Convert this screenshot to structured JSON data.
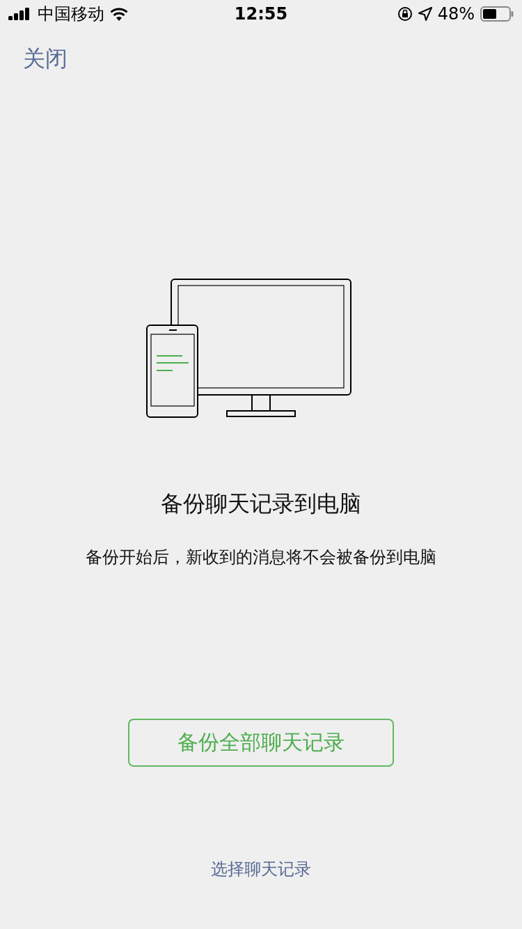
{
  "status_bar": {
    "carrier": "中国移动",
    "time": "12:55",
    "battery": "48%"
  },
  "nav": {
    "close": "关闭"
  },
  "title": "备份聊天记录到电脑",
  "description": "备份开始后，新收到的消息将不会被备份到电脑",
  "primary_button": "备份全部聊天记录",
  "secondary_link": "选择聊天记录"
}
